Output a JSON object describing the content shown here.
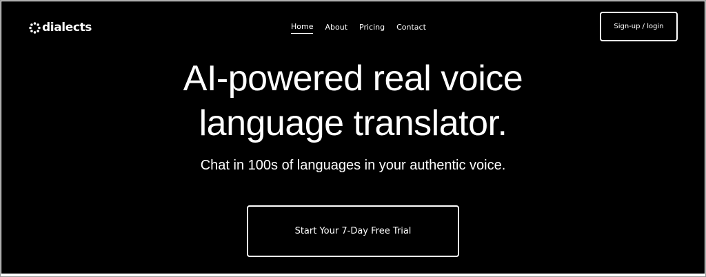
{
  "brand": {
    "name": "dialects",
    "logo_icon": "starburst-icon"
  },
  "nav": {
    "items": [
      {
        "label": "Home",
        "active": true
      },
      {
        "label": "About",
        "active": false
      },
      {
        "label": "Pricing",
        "active": false
      },
      {
        "label": "Contact",
        "active": false
      }
    ]
  },
  "header": {
    "login_label": "Sign-up / login"
  },
  "hero": {
    "title_line1": "AI-powered real voice",
    "title_line2": "language translator.",
    "subtitle": "Chat in 100s of languages in your authentic voice.",
    "cta_label": "Start Your 7-Day Free Trial"
  },
  "colors": {
    "background": "#000000",
    "foreground": "#ffffff"
  }
}
